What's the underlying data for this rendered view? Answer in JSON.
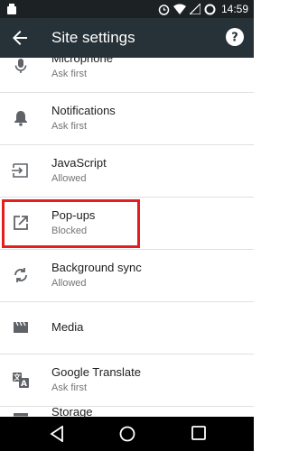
{
  "status_bar": {
    "time": "14:59"
  },
  "app_bar": {
    "title": "Site settings"
  },
  "items": [
    {
      "key": "microphone",
      "label": "Microphone",
      "sub": "Ask first"
    },
    {
      "key": "notifications",
      "label": "Notifications",
      "sub": "Ask first"
    },
    {
      "key": "javascript",
      "label": "JavaScript",
      "sub": "Allowed"
    },
    {
      "key": "popups",
      "label": "Pop-ups",
      "sub": "Blocked"
    },
    {
      "key": "background-sync",
      "label": "Background sync",
      "sub": "Allowed"
    },
    {
      "key": "media",
      "label": "Media",
      "sub": ""
    },
    {
      "key": "google-translate",
      "label": "Google Translate",
      "sub": "Ask first"
    },
    {
      "key": "storage",
      "label": "Storage",
      "sub": ""
    }
  ],
  "colors": {
    "status_bar": "#1c2124",
    "app_bar": "#263238",
    "highlight": "#e41e1e",
    "icon": "#5f6368"
  }
}
